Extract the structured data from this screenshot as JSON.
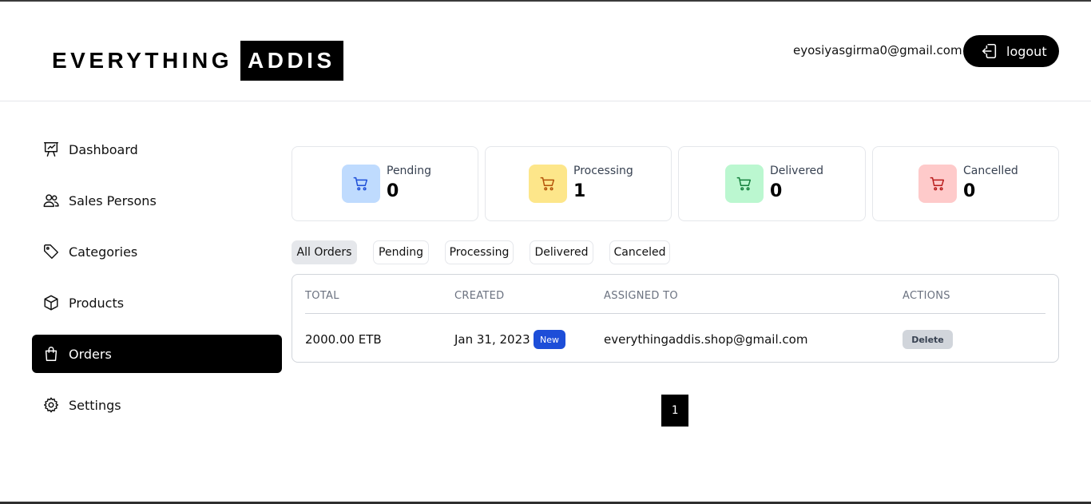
{
  "header": {
    "logo_part1": "EVERYTHING",
    "logo_part2": "ADDIS",
    "user_email": "eyosiyasgirma0@gmail.com",
    "logout_label": "logout"
  },
  "sidebar": {
    "items": [
      {
        "label": "Dashboard",
        "icon": "presentation-chart-icon"
      },
      {
        "label": "Sales Persons",
        "icon": "users-icon"
      },
      {
        "label": "Categories",
        "icon": "tag-icon"
      },
      {
        "label": "Products",
        "icon": "cube-icon"
      },
      {
        "label": "Orders",
        "icon": "shopping-bag-icon",
        "active": true
      },
      {
        "label": "Settings",
        "icon": "gear-icon"
      }
    ]
  },
  "stats": [
    {
      "label": "Pending",
      "value": "0",
      "icon": "cart-icon",
      "bg": "#bfdbfe",
      "fg": "#1d4ed8"
    },
    {
      "label": "Processing",
      "value": "1",
      "icon": "cart-icon",
      "bg": "#fde68a",
      "fg": "#b45309"
    },
    {
      "label": "Delivered",
      "value": "0",
      "icon": "cart-icon",
      "bg": "#bbf7d0",
      "fg": "#15803d"
    },
    {
      "label": "Cancelled",
      "value": "0",
      "icon": "cart-icon",
      "bg": "#fecaca",
      "fg": "#b91c1c"
    }
  ],
  "filters": {
    "selected": "All Orders",
    "options": [
      "All Orders",
      "Pending",
      "Processing",
      "Delivered",
      "Canceled"
    ]
  },
  "table": {
    "columns": [
      "TOTAL",
      "CREATED",
      "ASSIGNED TO",
      "ACTIONS"
    ],
    "rows": [
      {
        "total": "2000.00 ETB",
        "created": "Jan 31, 2023",
        "badge": "New",
        "assigned_to": "everythingaddis.shop@gmail.com",
        "action": "Delete"
      }
    ]
  },
  "pagination": {
    "current": "1"
  },
  "colors": {
    "accent": "#000000",
    "badge_new": "#1d4ed8"
  }
}
